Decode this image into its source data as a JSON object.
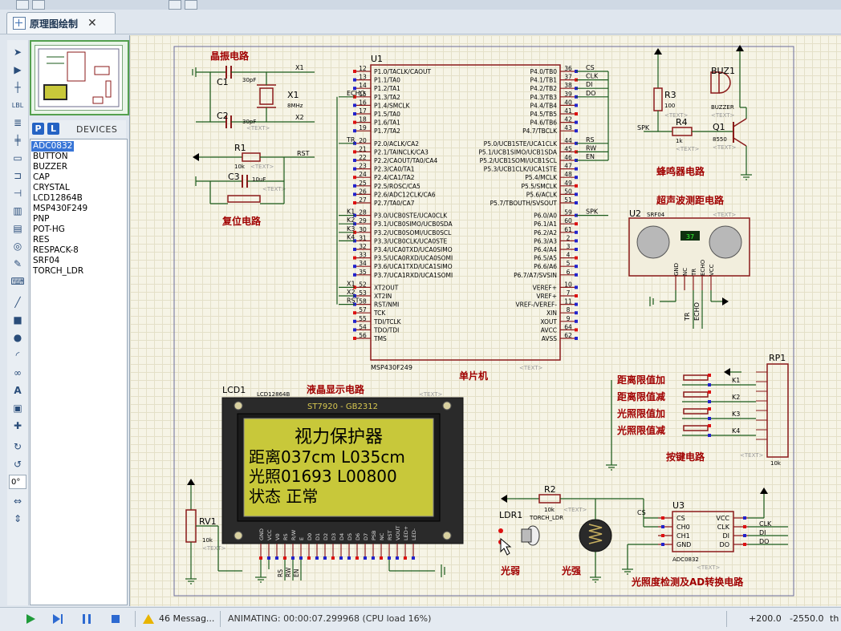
{
  "tab": {
    "label": "原理图绘制",
    "close": "✕"
  },
  "devices": {
    "p_label": "P",
    "l_label": "L",
    "title": "DEVICES",
    "items": [
      "ADC0832",
      "BUTTON",
      "BUZZER",
      "CAP",
      "CRYSTAL",
      "LCD12864B",
      "MSP430F249",
      "PNP",
      "POT-HG",
      "RES",
      "RESPACK-8",
      "SRF04",
      "TORCH_LDR"
    ],
    "selected": "ADC0832"
  },
  "tools": {
    "angle": "0°"
  },
  "schematic": {
    "titles": {
      "crystal": "晶振电路",
      "reset": "复位电路",
      "buzzer": "蜂鸣器电路",
      "ultrasonic": "超声波测距电路",
      "mcu": "单片机",
      "lcd": "液晶显示电路",
      "keys": "按键电路",
      "light": "光照度检测及AD转换电路",
      "weak": "光弱",
      "strong": "光强"
    },
    "mcu": {
      "ref": "U1",
      "part": "MSP430F249",
      "text": "<TEXT>",
      "left_pins": [
        {
          "n": "12",
          "name": "P1.0/TACLK/CAOUT"
        },
        {
          "n": "13",
          "name": "P1.1/TA0"
        },
        {
          "n": "14",
          "name": "P1.2/TA1"
        },
        {
          "n": "15",
          "name": "P1.3/TA2"
        },
        {
          "n": "16",
          "name": "P1.4/SMCLK"
        },
        {
          "n": "17",
          "name": "P1.5/TA0"
        },
        {
          "n": "18",
          "name": "P1.6/TA1"
        },
        {
          "n": "19",
          "name": "P1.7/TA2"
        },
        {
          "n": "20",
          "name": "P2.0/ACLK/CA2"
        },
        {
          "n": "21",
          "name": "P2.1/TAINCLK/CA3"
        },
        {
          "n": "22",
          "name": "P2.2/CAOUT/TA0/CA4"
        },
        {
          "n": "23",
          "name": "P2.3/CA0/TA1"
        },
        {
          "n": "24",
          "name": "P2.4/CA1/TA2"
        },
        {
          "n": "25",
          "name": "P2.5/ROSC/CA5"
        },
        {
          "n": "26",
          "name": "P2.6/ADC12CLK/CA6"
        },
        {
          "n": "27",
          "name": "P2.7/TA0/CA7"
        },
        {
          "n": "28",
          "name": "P3.0/UCB0STE/UCA0CLK"
        },
        {
          "n": "29",
          "name": "P3.1/UCB0SIMO/UCB0SDA"
        },
        {
          "n": "30",
          "name": "P3.2/UCB0SOMI/UCB0SCL"
        },
        {
          "n": "31",
          "name": "P3.3/UCB0CLK/UCA0STE"
        },
        {
          "n": "32",
          "name": "P3.4/UCA0TXD/UCA0SIMO"
        },
        {
          "n": "33",
          "name": "P3.5/UCA0RXD/UCA0SOMI"
        },
        {
          "n": "34",
          "name": "P3.6/UCA1TXD/UCA1SIMO"
        },
        {
          "n": "35",
          "name": "P3.7/UCA1RXD/UCA1SOMI"
        },
        {
          "n": "52",
          "name": "XT2OUT"
        },
        {
          "n": "53",
          "name": "XT2IN"
        },
        {
          "n": "58",
          "name": "RST/NMI"
        },
        {
          "n": "57",
          "name": "TCK"
        },
        {
          "n": "55",
          "name": "TDI/TCLK"
        },
        {
          "n": "54",
          "name": "TDO/TDI"
        },
        {
          "n": "56",
          "name": "TMS"
        }
      ],
      "right_pins": [
        {
          "n": "36",
          "name": "P4.0/TB0"
        },
        {
          "n": "37",
          "name": "P4.1/TB1"
        },
        {
          "n": "38",
          "name": "P4.2/TB2"
        },
        {
          "n": "39",
          "name": "P4.3/TB3"
        },
        {
          "n": "40",
          "name": "P4.4/TB4"
        },
        {
          "n": "41",
          "name": "P4.5/TB5"
        },
        {
          "n": "42",
          "name": "P4.6/TB6"
        },
        {
          "n": "43",
          "name": "P4.7/TBCLK"
        },
        {
          "n": "44",
          "name": "P5.0/UCB1STE/UCA1CLK"
        },
        {
          "n": "45",
          "name": "P5.1/UCB1SIMO/UCB1SDA"
        },
        {
          "n": "46",
          "name": "P5.2/UCB1SOMI/UCB1SCL"
        },
        {
          "n": "47",
          "name": "P5.3/UCB1CLK/UCA1STE"
        },
        {
          "n": "48",
          "name": "P5.4/MCLK"
        },
        {
          "n": "49",
          "name": "P5.5/SMCLK"
        },
        {
          "n": "50",
          "name": "P5.6/ACLK"
        },
        {
          "n": "51",
          "name": "P5.7/TBOUTH/SVSOUT"
        },
        {
          "n": "59",
          "name": "P6.0/A0"
        },
        {
          "n": "60",
          "name": "P6.1/A1"
        },
        {
          "n": "61",
          "name": "P6.2/A2"
        },
        {
          "n": "2",
          "name": "P6.3/A3"
        },
        {
          "n": "3",
          "name": "P6.4/A4"
        },
        {
          "n": "4",
          "name": "P6.5/A5"
        },
        {
          "n": "5",
          "name": "P6.6/A6"
        },
        {
          "n": "6",
          "name": "P6.7/A7/SVSIN"
        },
        {
          "n": "10",
          "name": "VEREF+"
        },
        {
          "n": "7",
          "name": "VREF+"
        },
        {
          "n": "11",
          "name": "VREF-/VEREF-"
        },
        {
          "n": "8",
          "name": "XIN"
        },
        {
          "n": "9",
          "name": "XOUT"
        },
        {
          "n": "64",
          "name": "AVCC"
        },
        {
          "n": "62",
          "name": "AVSS"
        }
      ],
      "left_nets": {
        "echo": "ECHO",
        "tr": "TR",
        "k1": "K1",
        "k2": "K2",
        "k3": "K3",
        "k4": "K4",
        "x1": "X1",
        "x2": "X2",
        "rst": "RST"
      },
      "right_nets": {
        "cs": "CS",
        "clk": "CLK",
        "di": "DI",
        "do": "DO",
        "rs": "RS",
        "rw": "RW",
        "en": "EN",
        "spk": "SPK"
      }
    },
    "crystal": {
      "c1": "C1",
      "c1v": "30pF",
      "c2": "C2",
      "c2v": "30pF",
      "x1": "X1",
      "x1v": "8MHz",
      "net1": "X1",
      "net2": "X2",
      "text": "<TEXT>"
    },
    "reset": {
      "r1": "R1",
      "r1v": "10k",
      "c3": "C3",
      "c3v": "10uF",
      "net": "RST",
      "text": "<TEXT>"
    },
    "buzzer": {
      "r3": "R3",
      "r3v": "100",
      "r4": "R4",
      "r4v": "1k",
      "buz": "BUZ1",
      "buzv": "BUZZER",
      "q1": "Q1",
      "q1v": "8550",
      "net": "SPK",
      "text": "<TEXT>"
    },
    "ultrasonic": {
      "ref": "U2",
      "part": "SRF04",
      "reading": "37",
      "pins": [
        "GND",
        "NC",
        "TR",
        "ECHO",
        "VCC"
      ],
      "nets": [
        "TR",
        "ECHO"
      ],
      "text": "<TEXT>"
    },
    "lcd": {
      "ref": "LCD1",
      "part": "LCD12864B",
      "controller": "ST7920 - GB2312",
      "text": "<TEXT>",
      "line1": "视力保护器",
      "line2": "距离037cm L035cm",
      "line3": "光照01693 L00800",
      "line4": "状态    正常",
      "pins": [
        "GND",
        "VCC",
        "V0",
        "RS",
        "R/W",
        "E",
        "D0",
        "D1",
        "D2",
        "D3",
        "D4",
        "D5",
        "D6",
        "D7",
        "PSB",
        "NC",
        "RST",
        "VOUT",
        "LED+",
        "LED-"
      ],
      "nets": [
        "RS",
        "RW",
        "EN"
      ]
    },
    "rv1": {
      "ref": "RV1",
      "val": "10k",
      "text": "<TEXT>"
    },
    "keys": {
      "ref": "RP1",
      "val": "10k",
      "labels": [
        "距离限值加",
        "距离限值减",
        "光照限值加",
        "光照限值减"
      ],
      "nets": [
        "K1",
        "K2",
        "K3",
        "K4"
      ],
      "text": "<TEXT>"
    },
    "light": {
      "ldr": "LDR1",
      "ldrv": "TORCH_LDR",
      "r2": "R2",
      "r2v": "10k",
      "adc": "U3",
      "adcv": "ADC0832",
      "adc_left": [
        "CS",
        "CH0",
        "CH1",
        "GND"
      ],
      "adc_right": [
        "VCC",
        "CLK",
        "DI",
        "DO"
      ],
      "nets": [
        "CS",
        "CLK",
        "DI",
        "DO"
      ],
      "text": "<TEXT>"
    }
  },
  "status": {
    "messages": "46 Messag...",
    "animating": "ANIMATING: 00:00:07.299968 (CPU load 16%)",
    "x": "+200.0",
    "y": "-2550.0",
    "unit": "th"
  },
  "colors": {
    "wire": "#1a5a1a",
    "body": "#8b1a1a",
    "label": "#c00000",
    "title": "#a00000",
    "lcd_screen": "#c8c83a",
    "lcd_frame": "#2a2a2a",
    "grid": "#e4e0c8"
  }
}
